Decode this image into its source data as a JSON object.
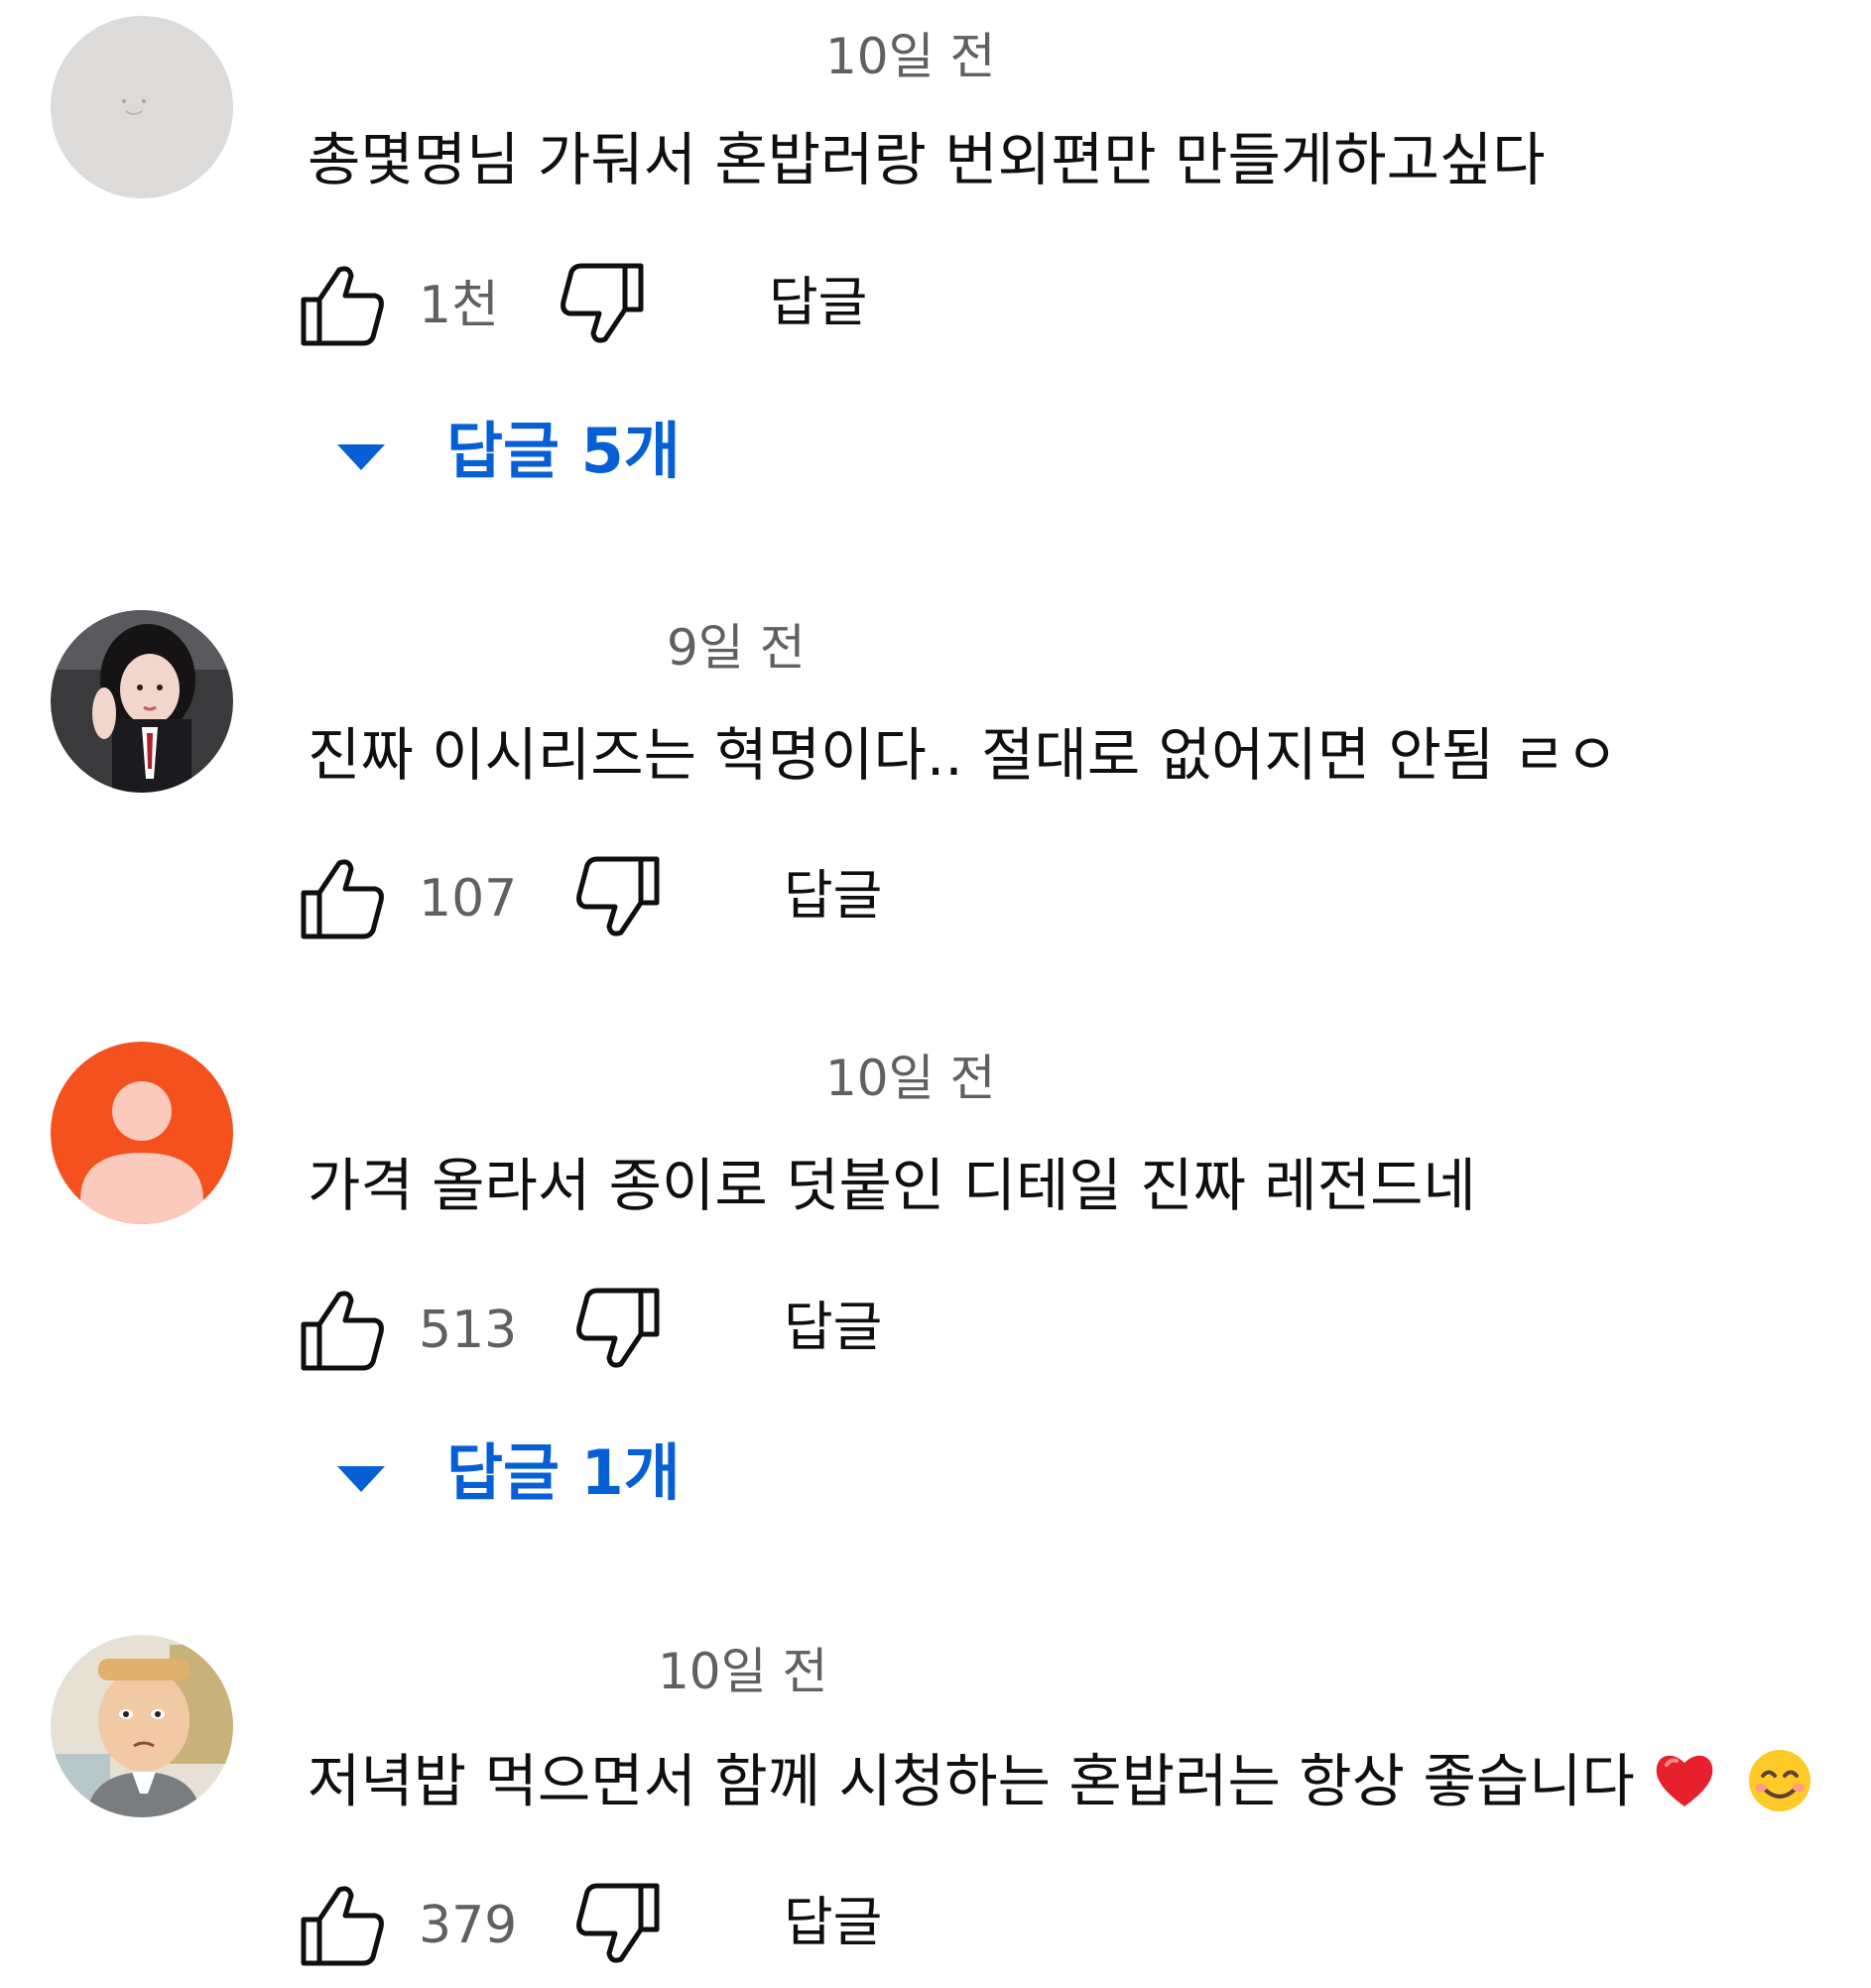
{
  "accent_color": "#065fd4",
  "comments": [
    {
      "avatar": "gray-blob-avatar",
      "timestamp": "10일 전",
      "text": "총몇명님 가둬서 혼밥러랑 번외편만 만들게하고싶다",
      "likes": "1천",
      "reply_label": "답글",
      "replies_label": "답글 5개"
    },
    {
      "avatar": "photo-avatar",
      "timestamp": "9일 전",
      "text": "진짜 이시리즈는 혁명이다.. 절대로 없어지면 안됨 ㄹㅇ",
      "likes": "107",
      "reply_label": "답글"
    },
    {
      "avatar": "default-person-avatar",
      "avatar_color": "#f4511e",
      "timestamp": "10일 전",
      "text": "가격 올라서 종이로 덧붙인 디테일 진짜 레전드네",
      "likes": "513",
      "reply_label": "답글",
      "replies_label": "답글 1개"
    },
    {
      "avatar": "cartoon-avatar",
      "timestamp": "10일 전",
      "text": "저녁밥 먹으면서 함께 시청하는 혼밥러는 항상 좋습니다",
      "text_emojis": [
        "heart-emoji",
        "smiling-face-emoji"
      ],
      "likes": "379",
      "reply_label": "답글"
    }
  ]
}
